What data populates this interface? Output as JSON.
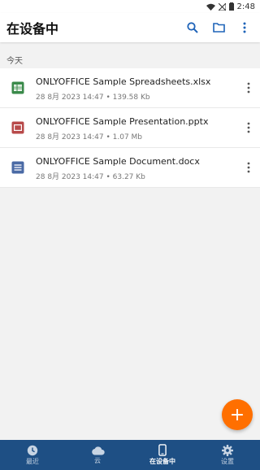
{
  "status_bar": {
    "time": "2:48"
  },
  "app_bar": {
    "title": "在设备中"
  },
  "section": {
    "label": "今天"
  },
  "files": [
    {
      "name": "ONLYOFFICE Sample Spreadsheets.xlsx",
      "meta": "28 8月 2023 14:47 • 139.58 Kb",
      "icon": "spreadsheet-icon",
      "color": "#3a8a4a"
    },
    {
      "name": "ONLYOFFICE Sample Presentation.pptx",
      "meta": "28 8月 2023 14:47 • 1.07 Mb",
      "icon": "presentation-icon",
      "color": "#b84a4a"
    },
    {
      "name": "ONLYOFFICE Sample Document.docx",
      "meta": "28 8月 2023 14:47 • 63.27 Kb",
      "icon": "document-icon",
      "color": "#4a6aa5"
    }
  ],
  "fab": {
    "label": "+",
    "color": "#ff6f00"
  },
  "bottom_nav": {
    "items": [
      {
        "label": "最近",
        "icon": "clock-icon"
      },
      {
        "label": "云",
        "icon": "cloud-icon"
      },
      {
        "label": "在设备中",
        "icon": "phone-icon",
        "active": true
      },
      {
        "label": "设置",
        "icon": "gear-icon"
      }
    ],
    "background": "#1e4f84"
  }
}
